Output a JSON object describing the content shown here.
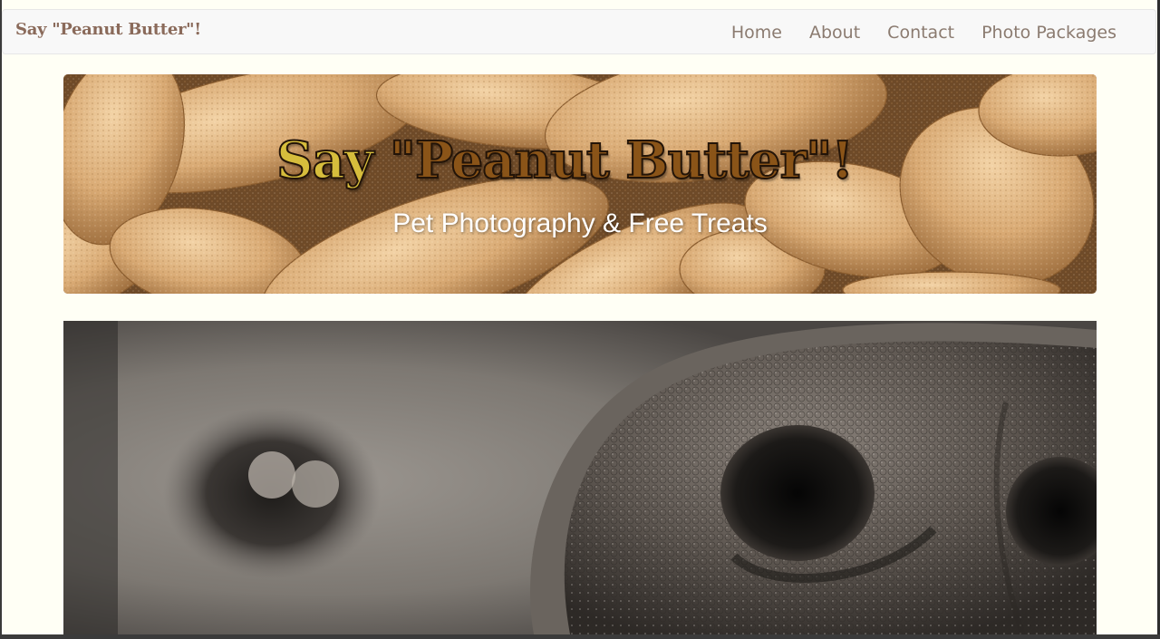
{
  "navbar": {
    "brand": "Say \"Peanut Butter\"!",
    "links": [
      "Home",
      "About",
      "Contact",
      "Photo Packages"
    ]
  },
  "hero": {
    "title_say": "Say ",
    "title_rest": "\"Peanut Butter\"!",
    "subtitle": "Pet Photography & Free Treats"
  },
  "colors": {
    "page_bg": "#fffff5",
    "brand": "#8a6a5a",
    "nav_link": "#8b7b70",
    "title_yellow": "#d6bd3c",
    "title_brown": "#8a5418"
  },
  "images": {
    "hero_image": "peanuts",
    "feature_image": "dog-nose-closeup"
  }
}
